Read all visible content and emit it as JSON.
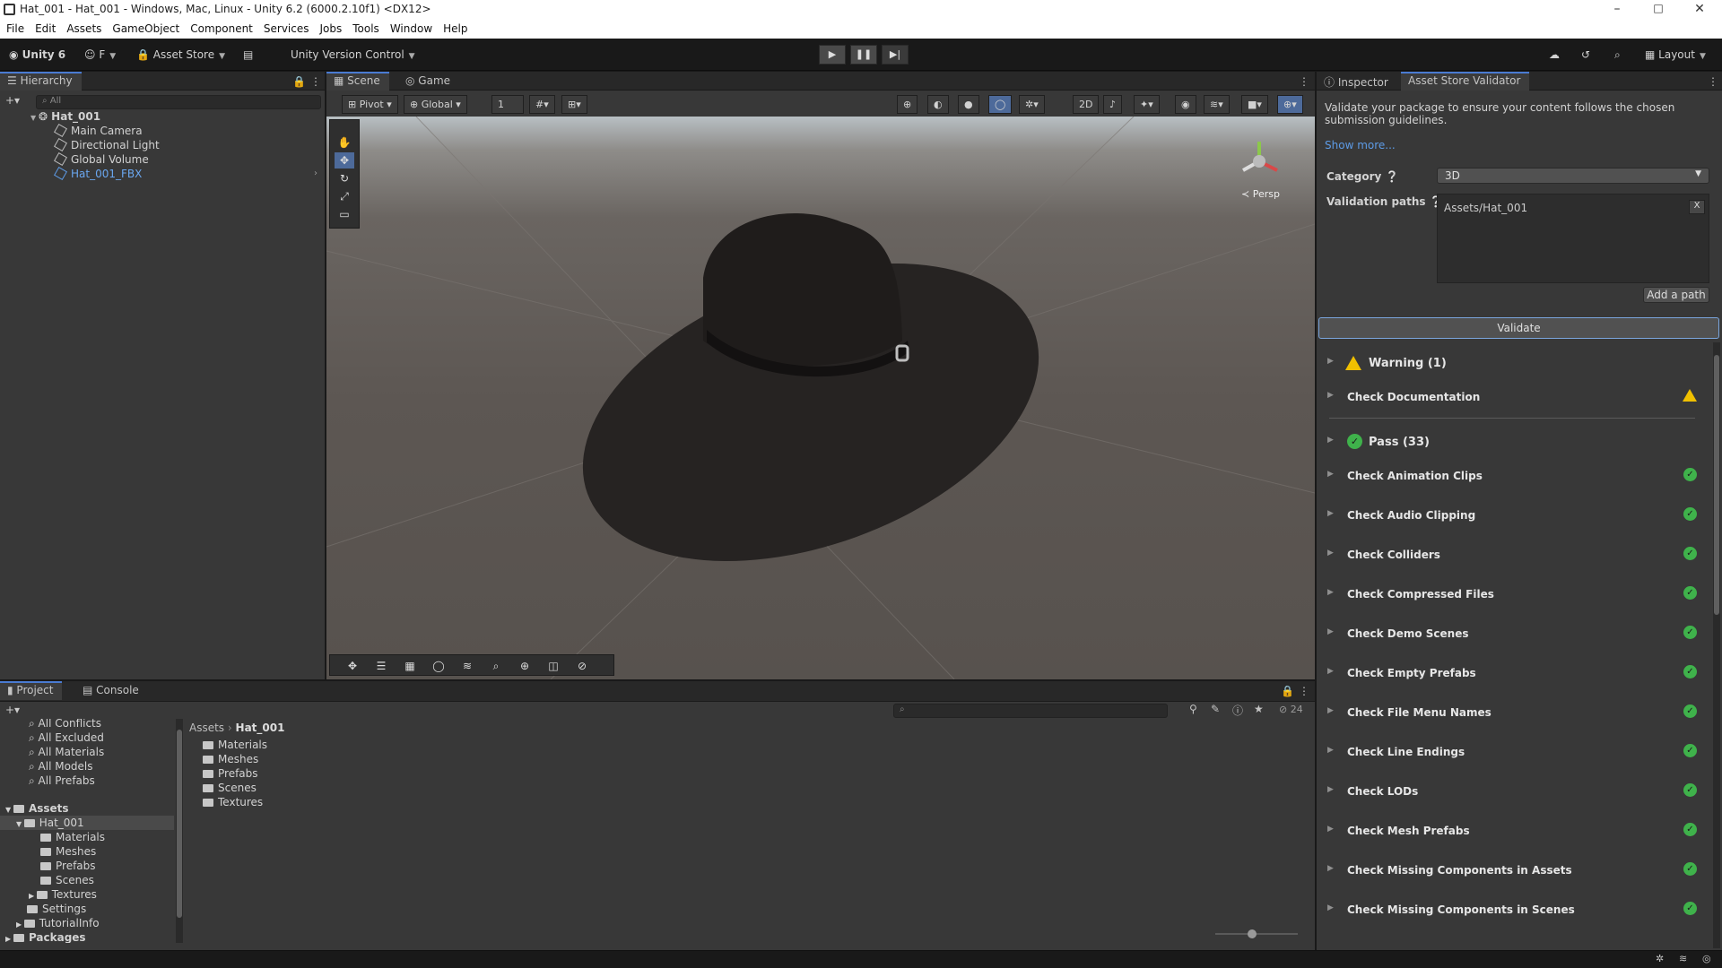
{
  "window": {
    "title": "Hat_001 - Hat_001 - Windows, Mac, Linux - Unity 6.2 (6000.2.10f1) <DX12>",
    "minimize": "–",
    "maximize": "□",
    "close": "✕"
  },
  "menu": [
    "File",
    "Edit",
    "Assets",
    "GameObject",
    "Component",
    "Services",
    "Jobs",
    "Tools",
    "Window",
    "Help"
  ],
  "toolbar": {
    "account": "Unity 6",
    "user": "F",
    "asset_store": "Asset Store",
    "version_control": "Unity Version Control",
    "layout": "Layout"
  },
  "hierarchy": {
    "tab": "Hierarchy",
    "search_placeholder": "All",
    "items": [
      "Hat_001",
      "Main Camera",
      "Directional Light",
      "Global Volume",
      "Hat_001_FBX"
    ]
  },
  "scene": {
    "tabs": [
      "Scene",
      "Game"
    ],
    "pivot": "Pivot",
    "global": "Global",
    "snap_value": "1",
    "persp": "Persp"
  },
  "inspector": {
    "tabs": [
      "Inspector",
      "Asset Store Validator"
    ],
    "description": "Validate your package to ensure your content follows the chosen submission guidelines.",
    "show_more": "Show more...",
    "category_label": "Category",
    "category_value": "3D",
    "paths_label": "Validation paths",
    "path_value": "Assets/Hat_001",
    "remove": "X",
    "add_path": "Add a path",
    "validate": "Validate",
    "warning_header": "Warning (1)",
    "warnings": [
      "Check Documentation"
    ],
    "pass_header": "Pass (33)",
    "passes": [
      "Check Animation Clips",
      "Check Audio Clipping",
      "Check Colliders",
      "Check Compressed Files",
      "Check Demo Scenes",
      "Check Empty Prefabs",
      "Check File Menu Names",
      "Check Line Endings",
      "Check LODs",
      "Check Mesh Prefabs",
      "Check Missing Components in Assets",
      "Check Missing Components in Scenes"
    ],
    "colors": {
      "pass": "#3fb24b",
      "warning": "#f0c000"
    }
  },
  "project": {
    "tabs": [
      "Project",
      "Console"
    ],
    "hidden_count": "24",
    "favorites": [
      "All Conflicts",
      "All Excluded",
      "All Materials",
      "All Models",
      "All Prefabs"
    ],
    "tree": [
      "Assets",
      "Hat_001",
      "Materials",
      "Meshes",
      "Prefabs",
      "Scenes",
      "Textures",
      "Settings",
      "TutorialInfo",
      "Packages"
    ],
    "breadcrumb": [
      "Assets",
      "Hat_001"
    ],
    "contents": [
      "Materials",
      "Meshes",
      "Prefabs",
      "Scenes",
      "Textures"
    ]
  }
}
